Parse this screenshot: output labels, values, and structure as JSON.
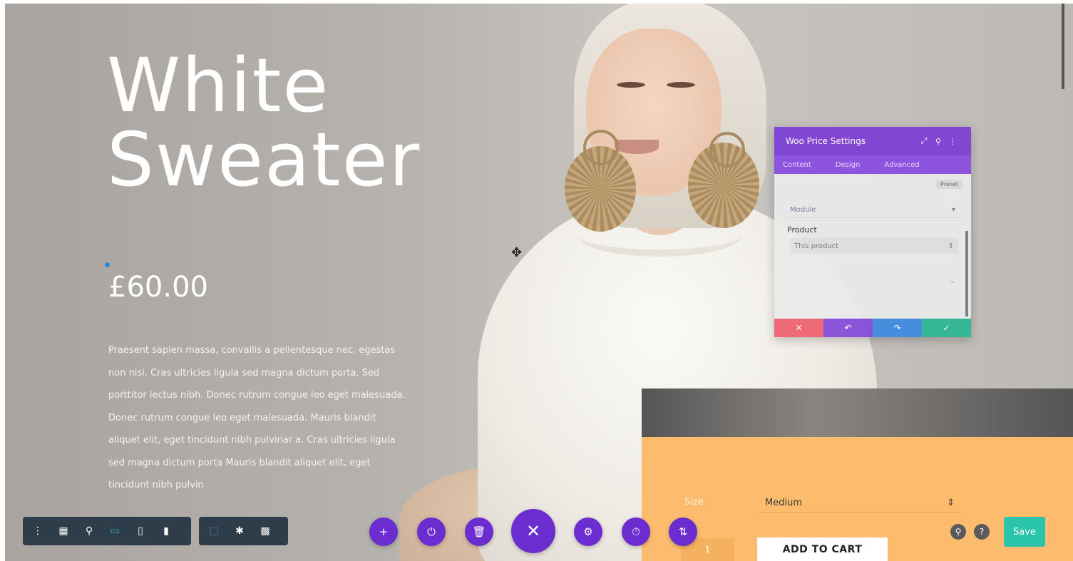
{
  "hero": {
    "title_line1": "White",
    "title_line2": "Sweater",
    "price": "£60.00",
    "description": "Praesent sapien massa, convallis a pellentesque nec, egestas non nisi. Cras ultricies ligula sed magna dictum porta. Sed porttitor lectus nibh. Donec rutrum congue leo eget malesuada. Donec rutrum congue leo eget malesuada. Mauris blandit aliquet elit, eget tincidunt nibh pulvinar a. Cras ultricies ligula sed magna dictum porta Mauris blandit aliquet elit, eget tincidunt nibh pulvin"
  },
  "settings_modal": {
    "title": "Woo Price Settings",
    "tabs": [
      "Content",
      "Design",
      "Advanced"
    ],
    "top_button": "Preset",
    "select_value": "Module",
    "product_label": "Product",
    "product_value": "This product",
    "footer": {
      "cancel_icon": "close-icon",
      "undo_icon": "undo-icon",
      "redo_icon": "redo-icon",
      "save_icon": "check-icon"
    }
  },
  "product_card": {
    "size_label": "Size",
    "size_value": "Medium",
    "quantity": "1",
    "add_to_cart": "ADD TO CART"
  },
  "toolbar_left": {
    "icons": [
      "menu-icon",
      "layout-icon",
      "zoom-icon",
      "desktop-icon",
      "tablet-icon",
      "phone-icon"
    ]
  },
  "toolbar_mid": {
    "icons": [
      "select-icon",
      "click-icon",
      "grid-icon"
    ]
  },
  "builder_actions": {
    "add": "+",
    "power": "⏻",
    "trash": "🗑",
    "close": "✕",
    "settings": "⚙",
    "history": "⏱",
    "portability": "⇅"
  },
  "right_controls": {
    "search": "🔍",
    "help": "?",
    "save": "Save"
  },
  "colors": {
    "purple": "#6c2dd0",
    "teal": "#29c4a9",
    "orange": "#fdbc6d",
    "toolbar": "#2f3c4a"
  }
}
